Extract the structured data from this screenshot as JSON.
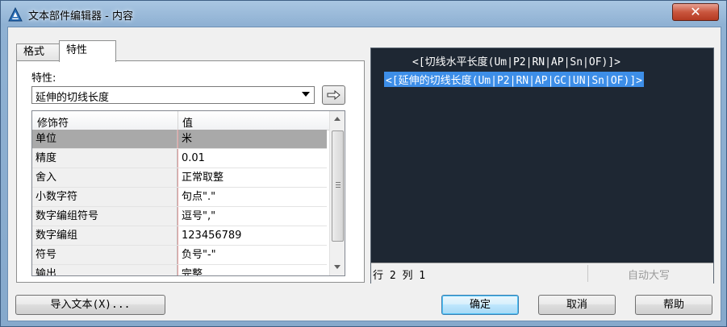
{
  "window": {
    "title": "文本部件编辑器 - 内容",
    "close_glyph": "✕"
  },
  "tabs": [
    {
      "label": "格式",
      "active": false
    },
    {
      "label": "特性",
      "active": true
    }
  ],
  "properties": {
    "label": "特性:",
    "selected": "延伸的切线长度",
    "insert_glyph": "⇨"
  },
  "grid": {
    "headers": [
      "修饰符",
      "值"
    ],
    "rows": [
      {
        "name": "单位",
        "value": "米"
      },
      {
        "name": "精度",
        "value": "0.01"
      },
      {
        "name": "舍入",
        "value": "正常取整"
      },
      {
        "name": "小数字符",
        "value": "句点\".\""
      },
      {
        "name": "数字编组符号",
        "value": "逗号\",\""
      },
      {
        "name": "数字编组",
        "value": "123456789"
      },
      {
        "name": "符号",
        "value": "负号\"-\""
      },
      {
        "name": "输出",
        "value": "完整"
      }
    ],
    "selected_index": 0
  },
  "editor": {
    "lines": [
      "<[切线水平长度(Um|P2|RN|AP|Sn|OF)]>",
      "<[延伸的切线长度(Um|P2|RN|AP|GC|UN|Sn|OF)]>"
    ],
    "status_position": "行 2 列 1",
    "status_caps": "自动大写"
  },
  "buttons": {
    "import": "导入文本(X)...",
    "ok": "确定",
    "cancel": "取消",
    "help": "帮助"
  },
  "colors": {
    "editor_bg": "#1e2733",
    "selection": "#3d8ee8",
    "selected_row": "#a9a9a9"
  }
}
